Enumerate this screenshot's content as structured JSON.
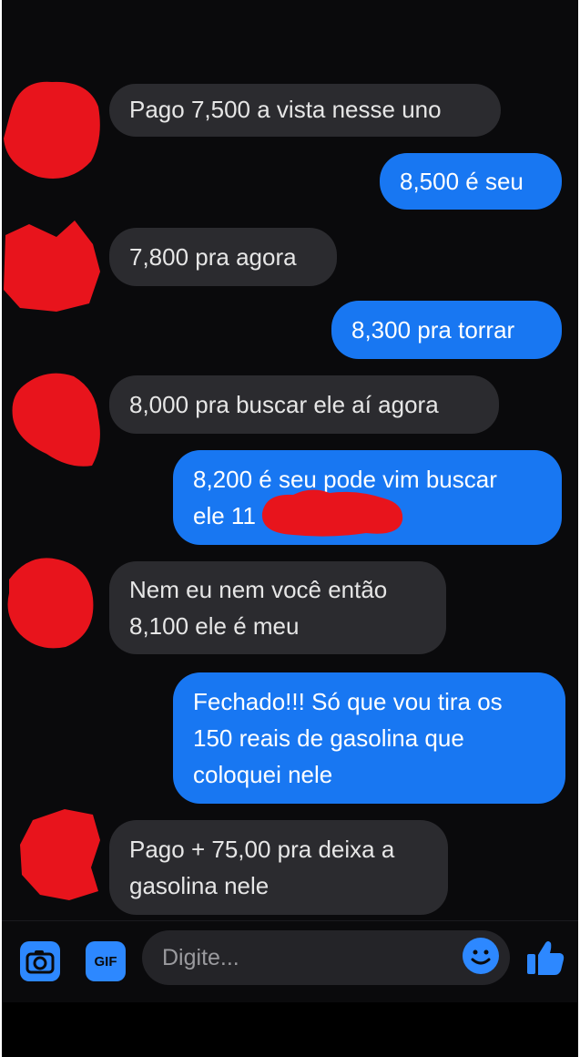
{
  "messages": [
    {
      "direction": "incoming",
      "lines": [
        "Pago 7,500 a vista nesse uno"
      ]
    },
    {
      "direction": "outgoing",
      "lines": [
        "8,500 é seu"
      ]
    },
    {
      "direction": "incoming",
      "lines": [
        "7,800 pra agora"
      ]
    },
    {
      "direction": "outgoing",
      "lines": [
        "8,300 pra torrar"
      ]
    },
    {
      "direction": "incoming",
      "lines": [
        "8,000 pra buscar ele aí agora"
      ]
    },
    {
      "direction": "outgoing",
      "lines": [
        "8,200 é seu pode vim buscar",
        "ele 11"
      ]
    },
    {
      "direction": "incoming",
      "lines": [
        "Nem eu nem você então",
        "8,100 ele é meu"
      ]
    },
    {
      "direction": "outgoing",
      "lines": [
        "Fechado!!! Só que vou tira os",
        "150 reais de gasolina que",
        "coloquei nele"
      ]
    },
    {
      "direction": "incoming",
      "lines": [
        "Pago + 75,00 pra deixa a",
        "gasolina nele"
      ]
    }
  ],
  "composer": {
    "placeholder": "Digite...",
    "gif_label": "GIF",
    "icons": [
      "camera-icon",
      "gif-icon",
      "emoji-icon",
      "thumbs-up-icon"
    ]
  },
  "colors": {
    "background": "#0a0a0c",
    "incoming_bubble": "#2b2b2f",
    "outgoing_bubble": "#1877f2",
    "accent": "#2d88ff",
    "redaction": "#e8141c"
  }
}
